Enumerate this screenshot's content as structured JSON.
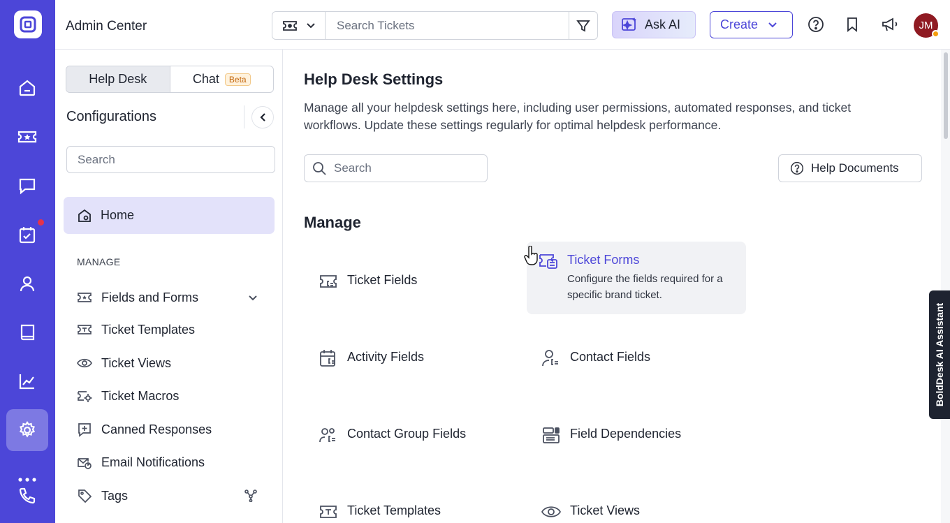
{
  "app": {
    "title": "Admin Center"
  },
  "rail": {
    "items": [
      "home-icon",
      "ticket-icon",
      "chat-icon",
      "tasks-icon",
      "contacts-icon",
      "knowledge-base-icon",
      "reports-icon",
      "settings-icon",
      "more-icon",
      "phone-icon"
    ],
    "active": "settings-icon",
    "accent": "#4c46d8"
  },
  "topbar": {
    "search_placeholder": "Search Tickets",
    "ask_ai_label": "Ask AI",
    "create_label": "Create",
    "avatar_initials": "JM"
  },
  "sidebar": {
    "tabs": [
      {
        "label": "Help Desk",
        "active": true
      },
      {
        "label": "Chat",
        "badge": "Beta"
      }
    ],
    "title": "Configurations",
    "search_placeholder": "Search",
    "home_label": "Home",
    "section_label": "MANAGE",
    "items": [
      {
        "label": "Fields and Forms",
        "icon": "fields-icon"
      },
      {
        "label": "Ticket Templates",
        "icon": "template-icon"
      },
      {
        "label": "Ticket Views",
        "icon": "eye-icon"
      },
      {
        "label": "Ticket Macros",
        "icon": "macro-icon"
      },
      {
        "label": "Canned Responses",
        "icon": "canned-icon"
      },
      {
        "label": "Email Notifications",
        "icon": "email-icon"
      },
      {
        "label": "Tags",
        "icon": "tag-icon"
      }
    ]
  },
  "main": {
    "title": "Help Desk Settings",
    "description": "Manage all your helpdesk settings here, including user permissions, automated responses, and ticket workflows. Update these settings regularly for optimal helpdesk performance.",
    "search_placeholder": "Search",
    "help_docs_label": "Help Documents",
    "section_title": "Manage",
    "cards": [
      {
        "title": "Ticket Fields"
      },
      {
        "title": "Ticket Forms",
        "description": "Configure the fields required for a specific brand ticket."
      },
      {
        "title": "Activity Fields"
      },
      {
        "title": "Contact Fields"
      },
      {
        "title": "Contact Group Fields"
      },
      {
        "title": "Field Dependencies"
      },
      {
        "title": "Ticket Templates"
      },
      {
        "title": "Ticket Views"
      }
    ]
  },
  "assistant_tab": {
    "label": "BoldDesk AI Assistant"
  }
}
